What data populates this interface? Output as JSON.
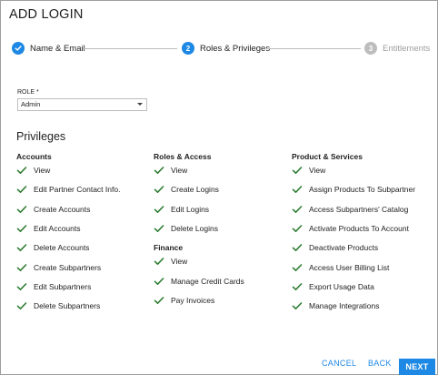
{
  "dialog": {
    "title": "ADD LOGIN"
  },
  "stepper": {
    "steps": [
      {
        "label": "Name & Email",
        "state": "done",
        "number": ""
      },
      {
        "label": "Roles & Privileges",
        "state": "active",
        "number": "2"
      },
      {
        "label": "Entitlements",
        "state": "pending",
        "number": "3"
      }
    ]
  },
  "role": {
    "label": "ROLE *",
    "value": "Admin"
  },
  "privileges": {
    "heading": "Privileges",
    "accounts": {
      "title": "Accounts",
      "items": [
        "View",
        "Edit Partner Contact Info.",
        "Create Accounts",
        "Edit Accounts",
        "Delete Accounts",
        "Create Subpartners",
        "Edit Subpartners",
        "Delete Subpartners"
      ]
    },
    "roles_access": {
      "title": "Roles & Access",
      "items": [
        "View",
        "Create Logins",
        "Edit Logins",
        "Delete Logins"
      ]
    },
    "finance": {
      "title": "Finance",
      "items": [
        "View",
        "Manage Credit Cards",
        "Pay Invoices"
      ]
    },
    "products": {
      "title": "Product & Services",
      "items": [
        "View",
        "Assign Products To Subpartner",
        "Access Subpartners' Catalog",
        "Activate Products To Account",
        "Deactivate Products",
        "Access User Billing List",
        "Export Usage Data",
        "Manage Integrations"
      ]
    }
  },
  "footer": {
    "cancel": "CANCEL",
    "back": "BACK",
    "next": "NEXT"
  },
  "colors": {
    "accent": "#1e88e5",
    "check": "#2e7d32",
    "pending": "#bdbdbd"
  }
}
